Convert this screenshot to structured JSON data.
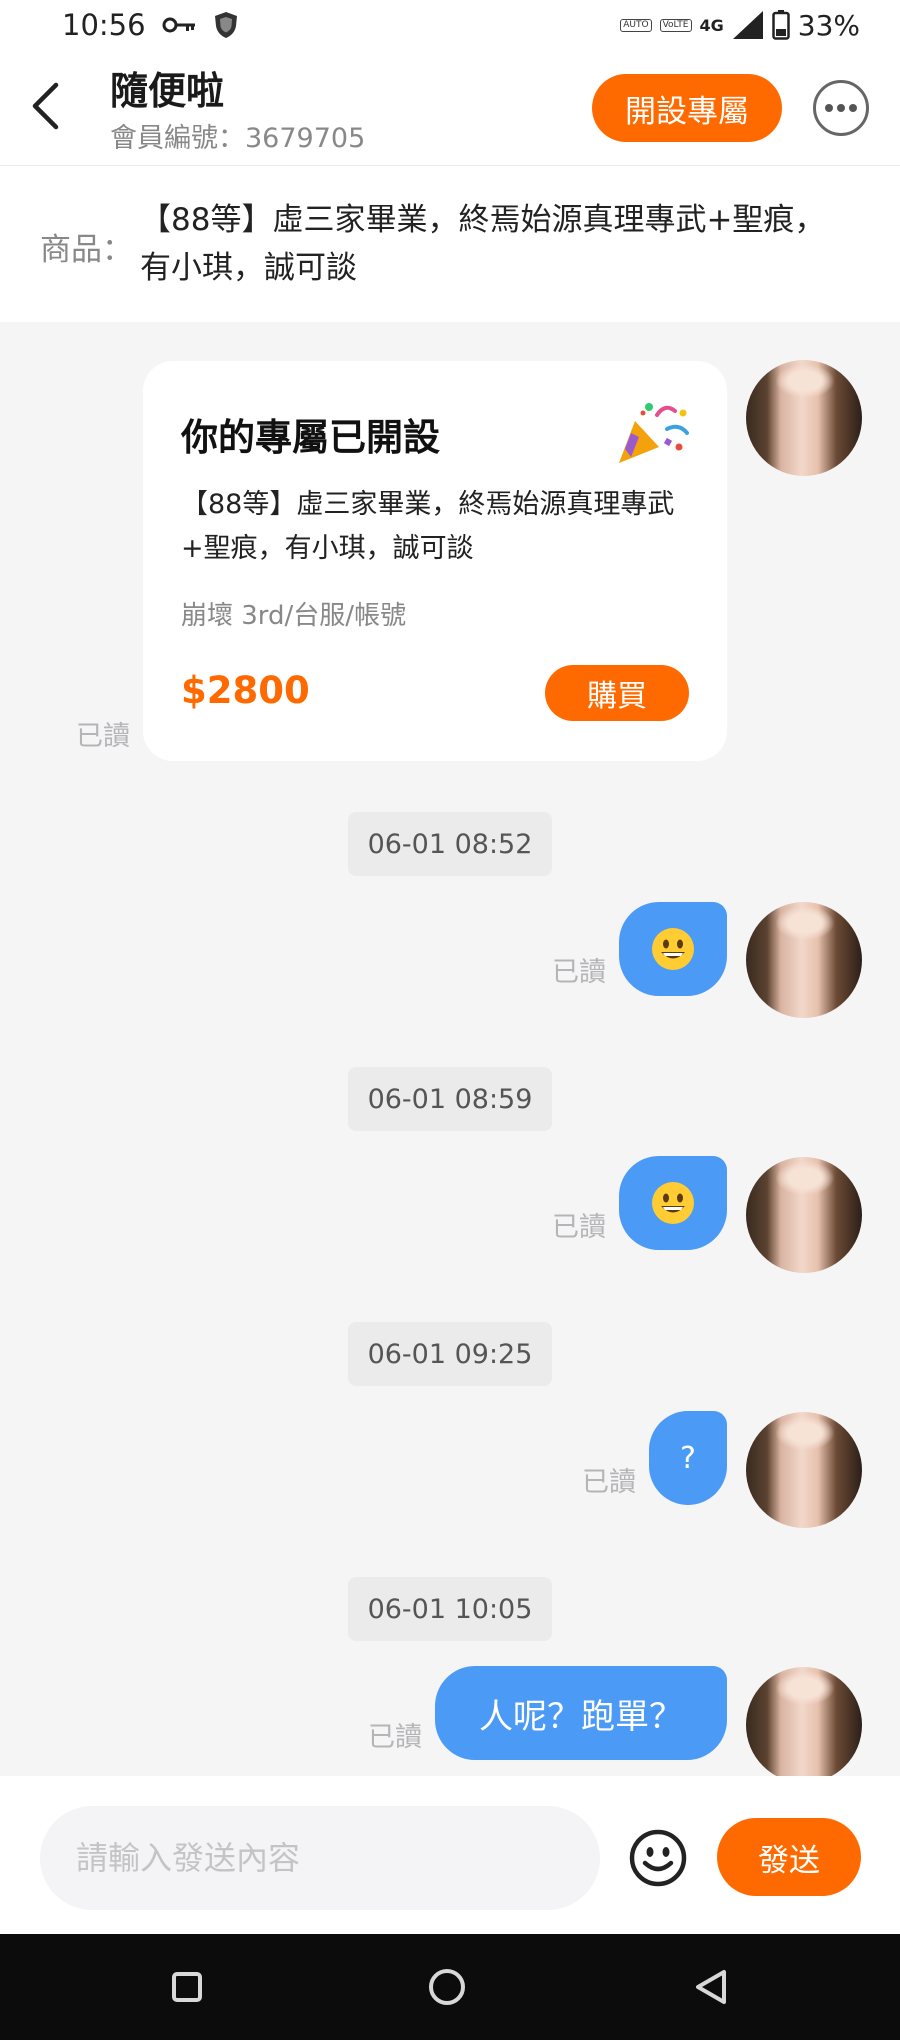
{
  "status_bar": {
    "time": "10:56",
    "icons": [
      "key-icon",
      "shield-icon",
      "auto-hd-icon",
      "volte-icon",
      "signal-icon",
      "battery-icon"
    ],
    "auto_label": "AUTO",
    "volte_label": "VoLTE",
    "network": "4G",
    "battery": "33%"
  },
  "header": {
    "title": "隨便啦",
    "member_id": "會員編號：3679705",
    "open_exclusive_label": "開設專屬"
  },
  "product": {
    "label": "商品：",
    "text": "【88等】虛三家畢業，終焉始源真理專武+聖痕，有小琪，誠可談"
  },
  "card": {
    "title": "你的專屬已開設",
    "description": "【88等】虛三家畢業，終焉始源真理專武+聖痕，有小琪，誠可談",
    "category": "崩壞 3rd/台服/帳號",
    "price": "$2800",
    "buy_label": "購買",
    "read": "已讀"
  },
  "messages": [
    {
      "time": "06-01 08:52",
      "type": "emoji",
      "content": "grinning-face",
      "read": "已讀"
    },
    {
      "time": "06-01 08:59",
      "type": "emoji",
      "content": "grinning-face",
      "read": "已讀"
    },
    {
      "time": "06-01 09:25",
      "type": "text",
      "content": "?",
      "read": "已讀"
    },
    {
      "time": "06-01 10:05",
      "type": "text",
      "content": "人呢？跑單？",
      "read": "已讀"
    }
  ],
  "input": {
    "placeholder": "請輸入發送內容",
    "send_label": "發送"
  },
  "colors": {
    "accent": "#ff6a00",
    "bubble": "#4b9af5",
    "background": "#f5f5f6"
  }
}
